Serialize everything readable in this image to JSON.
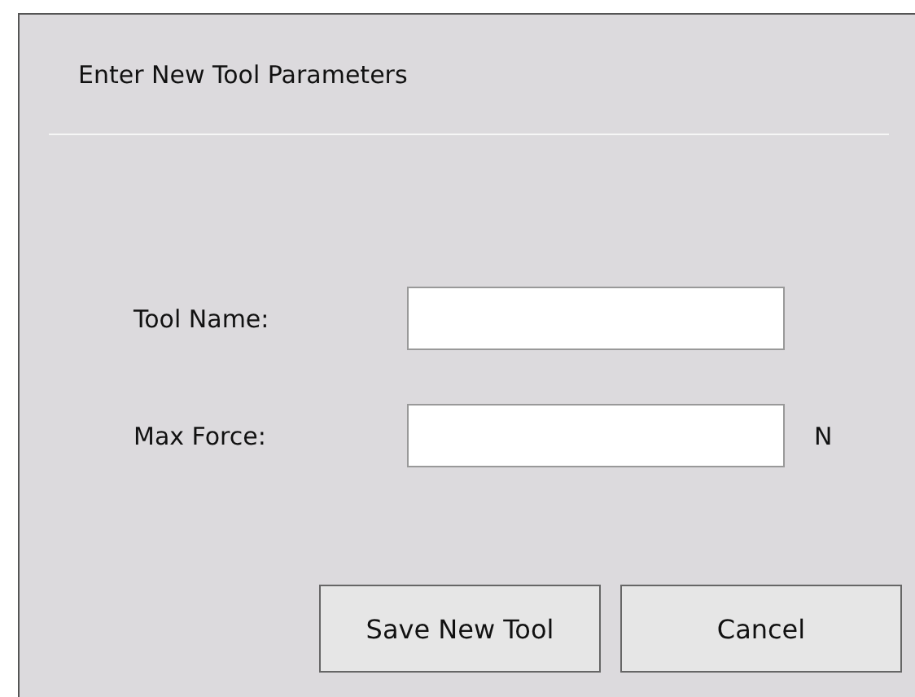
{
  "dialog": {
    "title": "Enter New Tool Parameters"
  },
  "fields": [
    {
      "label": "Tool Name:"
    },
    {
      "label": "Max Force:",
      "unit": "N"
    }
  ],
  "buttons": [
    "Save New Tool",
    "Cancel"
  ]
}
